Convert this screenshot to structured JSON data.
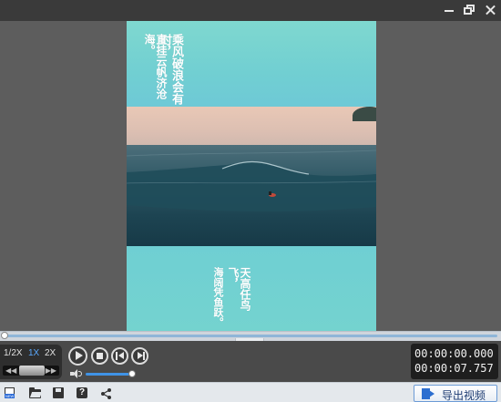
{
  "window": {
    "title": "",
    "minimize_label": "",
    "restore_label": "",
    "close_label": ""
  },
  "preview": {
    "caption_top": [
      "乘风破浪会有时，",
      "直挂云帆济沧海。"
    ],
    "caption_bottom": [
      "天高任鸟飞，",
      "海阔凭鱼跃。"
    ]
  },
  "speed": {
    "options": [
      "1/2X",
      "1X",
      "2X"
    ],
    "selected": "1X",
    "rewind_icon": "rewind-icon",
    "forward_icon": "fast-forward-icon"
  },
  "playback": {
    "play_icon": "play-icon",
    "stop_icon": "stop-icon",
    "prev_icon": "previous-icon",
    "next_icon": "next-icon",
    "volume_icon": "volume-icon",
    "volume_level": 0.95
  },
  "time": {
    "current": "00:00:00.000",
    "total": "00:00:07.757"
  },
  "timeline": {
    "collapse_glyph": "⌄",
    "position_fraction": 0.0
  },
  "toolbar": {
    "new_icon": "new-project-icon",
    "open_icon": "folder-open-icon",
    "save_icon": "save-icon",
    "help_glyph": "?",
    "share_icon": "share-icon",
    "export_label": "导出视频"
  },
  "colors": {
    "accent": "#3f93e6",
    "selected_speed": "#5aa9ff",
    "teal": "#72d0d1"
  }
}
